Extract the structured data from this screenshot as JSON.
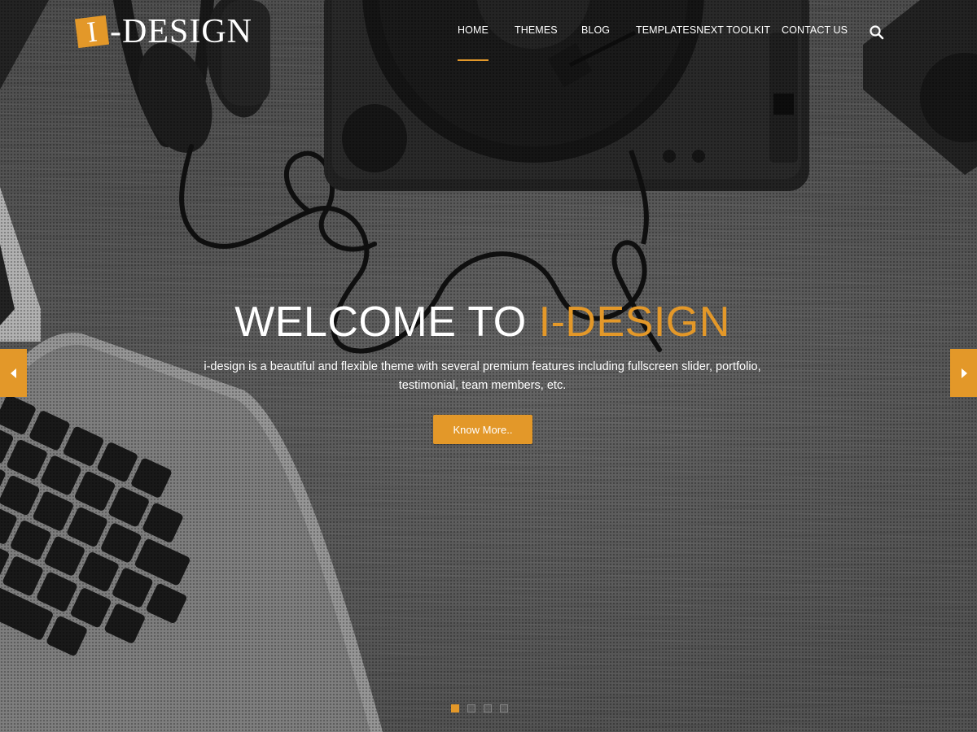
{
  "brand": {
    "logo_mark": "I",
    "logo_text": "-DESIGN",
    "accent_color": "#e39829"
  },
  "nav": {
    "items": [
      {
        "label": "HOME",
        "active": true
      },
      {
        "label": "THEMES"
      },
      {
        "label": "BLOG"
      },
      {
        "label": "TEMPLATESNEXT TOOLKIT"
      },
      {
        "label": "CONTACT US"
      }
    ],
    "search_icon": "search-icon"
  },
  "hero": {
    "title_plain": "WELCOME TO ",
    "title_accent": "I-DESIGN",
    "tagline": "i-design is a beautiful and flexible theme with several premium features including fullscreen slider, portfolio, testimonial, team members, etc.",
    "button_label": "Know More..",
    "prev_icon": "caret-left-icon",
    "next_icon": "caret-right-icon",
    "slide_count": 4,
    "active_slide": 1
  }
}
